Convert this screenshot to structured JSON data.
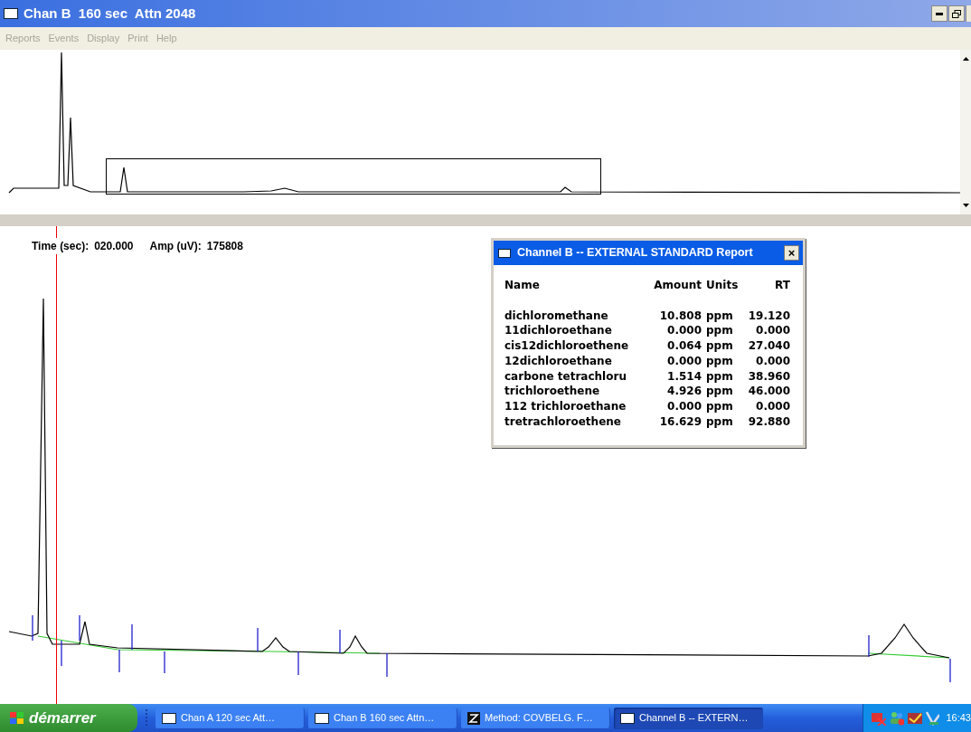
{
  "window": {
    "title": "Chan B  160 sec  Attn 2048"
  },
  "menu": [
    {
      "label": "Reports"
    },
    {
      "label": "Events"
    },
    {
      "label": "Display"
    },
    {
      "label": "Print"
    },
    {
      "label": "Help"
    }
  ],
  "readout": {
    "time_label": "Time (sec):",
    "time": "020.000",
    "amp_label": "Amp (uV):",
    "amp": "175808"
  },
  "report": {
    "title": "Channel B -- EXTERNAL STANDARD Report",
    "close": "×",
    "columns": [
      "Name",
      "Amount",
      "Units",
      "RT"
    ],
    "rows": [
      {
        "name": "dichloromethane",
        "amount": "10.808",
        "units": "ppm",
        "rt": "19.120"
      },
      {
        "name": "11dichloroethane",
        "amount": "0.000",
        "units": "ppm",
        "rt": "0.000"
      },
      {
        "name": "cis12dichloroethene",
        "amount": "0.064",
        "units": "ppm",
        "rt": "27.040"
      },
      {
        "name": "12dichloroethane",
        "amount": "0.000",
        "units": "ppm",
        "rt": "0.000"
      },
      {
        "name": "carbone tetrachloru",
        "amount": "1.514",
        "units": "ppm",
        "rt": "38.960"
      },
      {
        "name": "trichloroethene",
        "amount": "4.926",
        "units": "ppm",
        "rt": "46.000"
      },
      {
        "name": "112 trichloroethane",
        "amount": "0.000",
        "units": "ppm",
        "rt": "0.000"
      },
      {
        "name": "tretrachloroethene",
        "amount": "16.629",
        "units": "ppm",
        "rt": "92.880"
      }
    ]
  },
  "taskbar": {
    "start": "démarrer",
    "items": [
      {
        "label": "Chan A  120 sec  Att…",
        "kind": "window",
        "selected": false
      },
      {
        "label": "Chan B  160 sec  Attn…",
        "kind": "window",
        "selected": false
      },
      {
        "label": "Method: COVBELG.  F…",
        "kind": "method",
        "selected": false
      },
      {
        "label": "Channel B -- EXTERN…",
        "kind": "window",
        "selected": true
      }
    ],
    "clock": "16:43"
  }
}
